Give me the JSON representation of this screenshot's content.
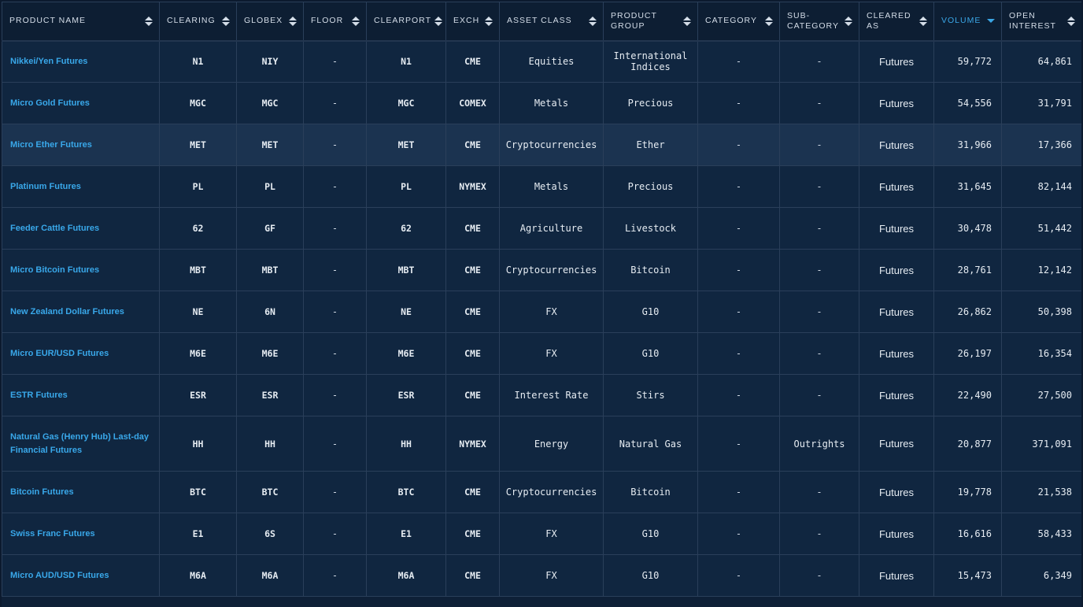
{
  "columns": [
    {
      "key": "product_name",
      "label": "PRODUCT NAME",
      "sort": "both"
    },
    {
      "key": "clearing",
      "label": "CLEARING",
      "sort": "both"
    },
    {
      "key": "globex",
      "label": "GLOBEX",
      "sort": "both"
    },
    {
      "key": "floor",
      "label": "FLOOR",
      "sort": "both"
    },
    {
      "key": "clearport",
      "label": "CLEARPORT",
      "sort": "both"
    },
    {
      "key": "exch",
      "label": "EXCH",
      "sort": "both"
    },
    {
      "key": "asset_class",
      "label": "ASSET CLASS",
      "sort": "both"
    },
    {
      "key": "product_group",
      "label": "PRODUCT\nGROUP",
      "sort": "both"
    },
    {
      "key": "category",
      "label": "CATEGORY",
      "sort": "both"
    },
    {
      "key": "sub_category",
      "label": "SUB-\nCATEGORY",
      "sort": "both"
    },
    {
      "key": "cleared_as",
      "label": "CLEARED\nAS",
      "sort": "both"
    },
    {
      "key": "volume",
      "label": "VOLUME",
      "sort": "desc"
    },
    {
      "key": "open_interest",
      "label": "OPEN\nINTEREST",
      "sort": "both"
    }
  ],
  "rows": [
    {
      "product_name": "Nikkei/Yen Futures",
      "clearing": "N1",
      "globex": "NIY",
      "floor": "-",
      "clearport": "N1",
      "exch": "CME",
      "asset_class": "Equities",
      "product_group": "International Indices",
      "category": "-",
      "sub_category": "-",
      "cleared_as": "Futures",
      "volume": "59,772",
      "open_interest": "64,861"
    },
    {
      "product_name": "Micro Gold Futures",
      "clearing": "MGC",
      "globex": "MGC",
      "floor": "-",
      "clearport": "MGC",
      "exch": "COMEX",
      "asset_class": "Metals",
      "product_group": "Precious",
      "category": "-",
      "sub_category": "-",
      "cleared_as": "Futures",
      "volume": "54,556",
      "open_interest": "31,791"
    },
    {
      "product_name": "Micro Ether Futures",
      "clearing": "MET",
      "globex": "MET",
      "floor": "-",
      "clearport": "MET",
      "exch": "CME",
      "asset_class": "Cryptocurrencies",
      "product_group": "Ether",
      "category": "-",
      "sub_category": "-",
      "cleared_as": "Futures",
      "volume": "31,966",
      "open_interest": "17,366"
    },
    {
      "product_name": "Platinum Futures",
      "clearing": "PL",
      "globex": "PL",
      "floor": "-",
      "clearport": "PL",
      "exch": "NYMEX",
      "asset_class": "Metals",
      "product_group": "Precious",
      "category": "-",
      "sub_category": "-",
      "cleared_as": "Futures",
      "volume": "31,645",
      "open_interest": "82,144"
    },
    {
      "product_name": "Feeder Cattle Futures",
      "clearing": "62",
      "globex": "GF",
      "floor": "-",
      "clearport": "62",
      "exch": "CME",
      "asset_class": "Agriculture",
      "product_group": "Livestock",
      "category": "-",
      "sub_category": "-",
      "cleared_as": "Futures",
      "volume": "30,478",
      "open_interest": "51,442"
    },
    {
      "product_name": "Micro Bitcoin Futures",
      "clearing": "MBT",
      "globex": "MBT",
      "floor": "-",
      "clearport": "MBT",
      "exch": "CME",
      "asset_class": "Cryptocurrencies",
      "product_group": "Bitcoin",
      "category": "-",
      "sub_category": "-",
      "cleared_as": "Futures",
      "volume": "28,761",
      "open_interest": "12,142"
    },
    {
      "product_name": "New Zealand Dollar Futures",
      "clearing": "NE",
      "globex": "6N",
      "floor": "-",
      "clearport": "NE",
      "exch": "CME",
      "asset_class": "FX",
      "product_group": "G10",
      "category": "-",
      "sub_category": "-",
      "cleared_as": "Futures",
      "volume": "26,862",
      "open_interest": "50,398"
    },
    {
      "product_name": "Micro EUR/USD Futures",
      "clearing": "M6E",
      "globex": "M6E",
      "floor": "-",
      "clearport": "M6E",
      "exch": "CME",
      "asset_class": "FX",
      "product_group": "G10",
      "category": "-",
      "sub_category": "-",
      "cleared_as": "Futures",
      "volume": "26,197",
      "open_interest": "16,354"
    },
    {
      "product_name": "ESTR Futures",
      "clearing": "ESR",
      "globex": "ESR",
      "floor": "-",
      "clearport": "ESR",
      "exch": "CME",
      "asset_class": "Interest Rate",
      "product_group": "Stirs",
      "category": "-",
      "sub_category": "-",
      "cleared_as": "Futures",
      "volume": "22,490",
      "open_interest": "27,500"
    },
    {
      "product_name": "Natural Gas (Henry Hub) Last-day Financial Futures",
      "clearing": "HH",
      "globex": "HH",
      "floor": "-",
      "clearport": "HH",
      "exch": "NYMEX",
      "asset_class": "Energy",
      "product_group": "Natural Gas",
      "category": "-",
      "sub_category": "Outrights",
      "cleared_as": "Futures",
      "volume": "20,877",
      "open_interest": "371,091"
    },
    {
      "product_name": "Bitcoin Futures",
      "clearing": "BTC",
      "globex": "BTC",
      "floor": "-",
      "clearport": "BTC",
      "exch": "CME",
      "asset_class": "Cryptocurrencies",
      "product_group": "Bitcoin",
      "category": "-",
      "sub_category": "-",
      "cleared_as": "Futures",
      "volume": "19,778",
      "open_interest": "21,538"
    },
    {
      "product_name": "Swiss Franc Futures",
      "clearing": "E1",
      "globex": "6S",
      "floor": "-",
      "clearport": "E1",
      "exch": "CME",
      "asset_class": "FX",
      "product_group": "G10",
      "category": "-",
      "sub_category": "-",
      "cleared_as": "Futures",
      "volume": "16,616",
      "open_interest": "58,433"
    },
    {
      "product_name": "Micro AUD/USD Futures",
      "clearing": "M6A",
      "globex": "M6A",
      "floor": "-",
      "clearport": "M6A",
      "exch": "CME",
      "asset_class": "FX",
      "product_group": "G10",
      "category": "-",
      "sub_category": "-",
      "cleared_as": "Futures",
      "volume": "15,473",
      "open_interest": "6,349"
    }
  ],
  "highlighted_row": 2,
  "colors": {
    "accent": "#39a8ea",
    "header_bg": "#0d1e33",
    "row_bg": "#102640",
    "row_highlight": "#1b3350"
  }
}
